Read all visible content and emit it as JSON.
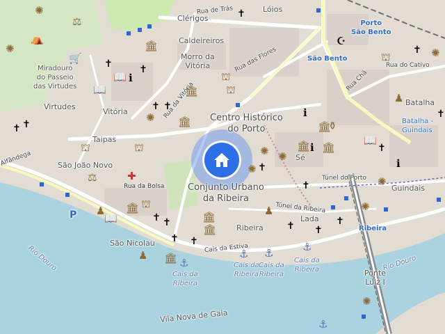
{
  "map": {
    "places": {
      "clerigos": "Clérigos",
      "loios": "Lóios",
      "porto_sao_bento": "Porto\nSão Bento",
      "caldeireiros": "Caldeireiros",
      "morro_vitoria": "Morro da\nVitória",
      "sao_bento": "São Bento",
      "miradouro": "Miradouro\ndo Passeio\ndas Virtudes",
      "virtudes": "Virtudes",
      "vitoria": "Vitória",
      "centro_historico": "Centro Histórico\ndo Porto",
      "batalha": "Batalha",
      "batalha_guindais": "Batalha -\nGuindais",
      "taipas": "Taipas",
      "se": "Sé",
      "sao_joao_novo": "São João Novo",
      "conjunto_urbano": "Conjunto Urbano\nda Ribeira",
      "guindais": "Guindais",
      "ribeira": "Ribeira",
      "lada": "Lada",
      "sao_nicolau": "São Nicolau",
      "ponte_luiz": "Ponte\nLuiz I",
      "vila_nova_gaia": "Vila Nova de Gaia",
      "alfandega": "Alfândega"
    },
    "streets": {
      "rua_tras": "Rua de Trás",
      "rua_flores": "Rua das Flores",
      "rua_vitoria": "Rua da Vitória",
      "rua_cha": "Rua Chã",
      "rua_cativo": "Rua do Cativo",
      "rua_bolsa": "Rua da Bolsa",
      "tunel_porto": "Túnel do Porto",
      "tunel_ribeira": "Túnel da Ribeira",
      "cais_estiva": "Cais da Estiva"
    },
    "water": {
      "rio_douro_1": "Rio Douro",
      "rio_douro_2": "Rio Douro",
      "cais_ribeira_1": "Cais da\nRibeira",
      "cais_ribeira_2": "Cais da\nRibeira",
      "cais_ribeira_3": "Cais da\nRibeira",
      "cais_ribeira_4": "Cais da\nRibeira"
    },
    "metro": {
      "ribeira_station": "Ribeira"
    },
    "parking_label": "P",
    "marker": "home",
    "colors": {
      "land": "#e2dcd3",
      "water": "#aad3df",
      "road": "#ffffff",
      "primary_road": "#f7fabf",
      "park": "#cdebb0",
      "building": "#d9d0c9",
      "marker_halo": "#5a8cf0",
      "marker": "#2e6ee6",
      "rail": "#707070"
    }
  }
}
